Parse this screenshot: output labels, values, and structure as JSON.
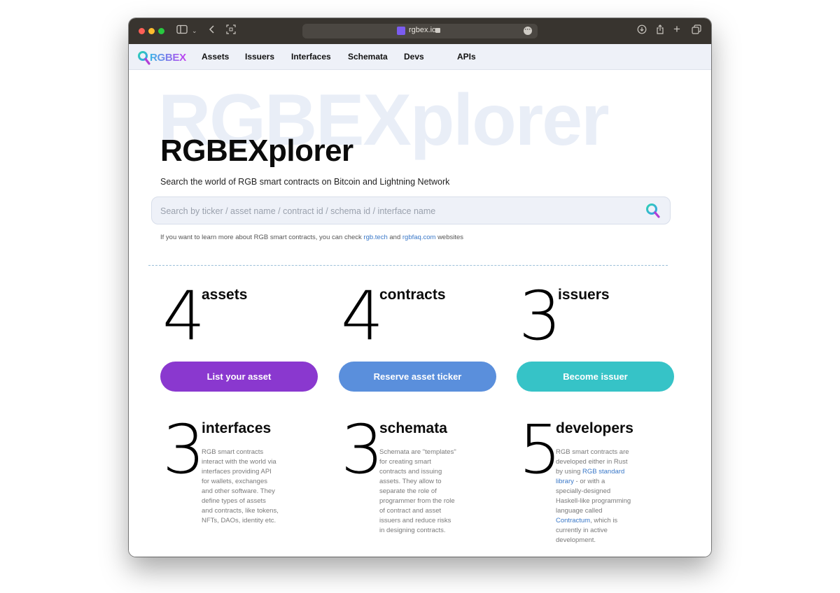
{
  "browser": {
    "url": "rgbex.io"
  },
  "nav": {
    "logo_text": "RGBEX",
    "items": [
      "Assets",
      "Issuers",
      "Interfaces",
      "Schemata",
      "Devs",
      "APIs"
    ]
  },
  "hero": {
    "watermark": "RGBEXplorer",
    "title": "RGBEXplorer",
    "subtitle": "Search the world of RGB smart contracts on Bitcoin and Lightning Network",
    "search_placeholder": "Search by ticker / asset name / contract id / schema id / interface name",
    "note_prefix": "If you want to learn more about RGB smart contracts, you can check",
    "note_link1": "rgb.tech",
    "note_and": "and",
    "note_link2": "rgbfaq.com",
    "note_suffix": "websites"
  },
  "stats": [
    {
      "count": "4",
      "label": "assets"
    },
    {
      "count": "4",
      "label": "contracts"
    },
    {
      "count": "3",
      "label": "issuers"
    }
  ],
  "buttons": {
    "list_asset": "List your asset",
    "reserve_ticker": "Reserve asset ticker",
    "become_issuer": "Become issuer"
  },
  "info": {
    "interfaces": {
      "count": "3",
      "label": "interfaces",
      "lines": [
        "RGB smart contracts",
        "interact with the world via",
        "interfaces providing API",
        "for wallets, exchanges",
        "and other software. They",
        "define types of assets",
        "and contracts, like tokens,",
        "NFTs, DAOs, identity etc."
      ]
    },
    "schemata": {
      "count": "3",
      "label": "schemata",
      "lines": [
        "Schemata are \"templates\"",
        "for creating smart",
        "contracts and issuing",
        "assets. They allow to",
        "separate the role of",
        "programmer from the role",
        "of contract and asset",
        "issuers and reduce risks",
        "in designing contracts."
      ]
    },
    "developers": {
      "count": "5",
      "label": "developers",
      "line1": "RGB smart contracts are",
      "line2": "developed either in Rust",
      "line3_prefix": "by using",
      "link1_part1": "RGB standard",
      "link1_part2": "library",
      "line4_suffix": "- or with a",
      "line5": "specially-designed",
      "line6": "Haskell-like programming",
      "line7": "language called",
      "link2": "Contractum",
      "line8_suffix": ", which is",
      "line9": "currently in active",
      "line10": "development."
    }
  },
  "colors": {
    "purple": "#8a38cf",
    "blue": "#5a8fdc",
    "teal": "#36c3c7",
    "link": "#3a78c8"
  }
}
